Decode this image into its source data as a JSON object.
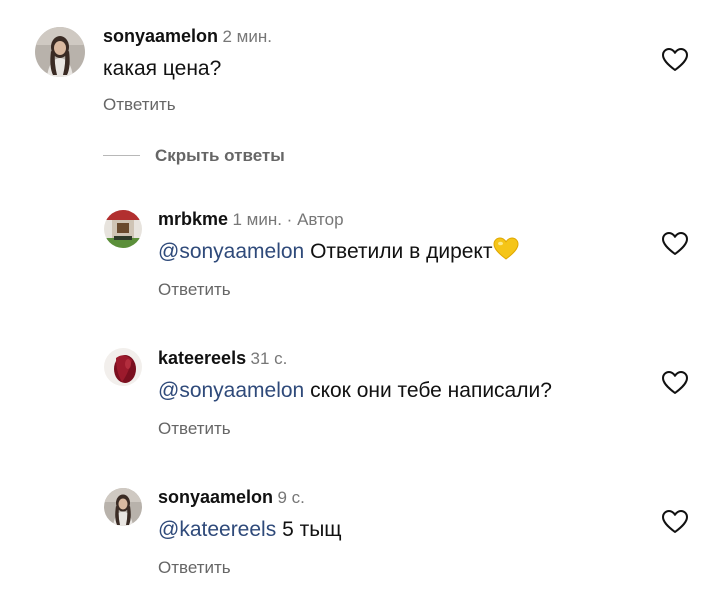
{
  "top_comment": {
    "username": "sonyaamelon",
    "time": "2 мин.",
    "text": "какая цена?",
    "reply_label": "Ответить"
  },
  "hide_replies_label": "Скрыть ответы",
  "replies": [
    {
      "username": "mrbkme",
      "time": "1 мин. · Автор",
      "mention": "@sonyaamelon",
      "text": "Ответили в директ",
      "emoji": "yellow-heart",
      "reply_label": "Ответить"
    },
    {
      "username": "kateereels",
      "time": "31 с.",
      "mention": "@sonyaamelon",
      "text": "скок они тебе написали?",
      "reply_label": "Ответить"
    },
    {
      "username": "sonyaamelon",
      "time": "9 с.",
      "mention": "@kateereels",
      "text": "5 тыщ",
      "reply_label": "Ответить"
    }
  ],
  "icons": {
    "like": "heart-outline-icon",
    "emoji": "yellow-heart-emoji"
  },
  "colors": {
    "mention": "#2f4a7a",
    "secondary_text": "#777777",
    "heart_outline": "#111111",
    "yellow_heart": "#f5c518"
  }
}
